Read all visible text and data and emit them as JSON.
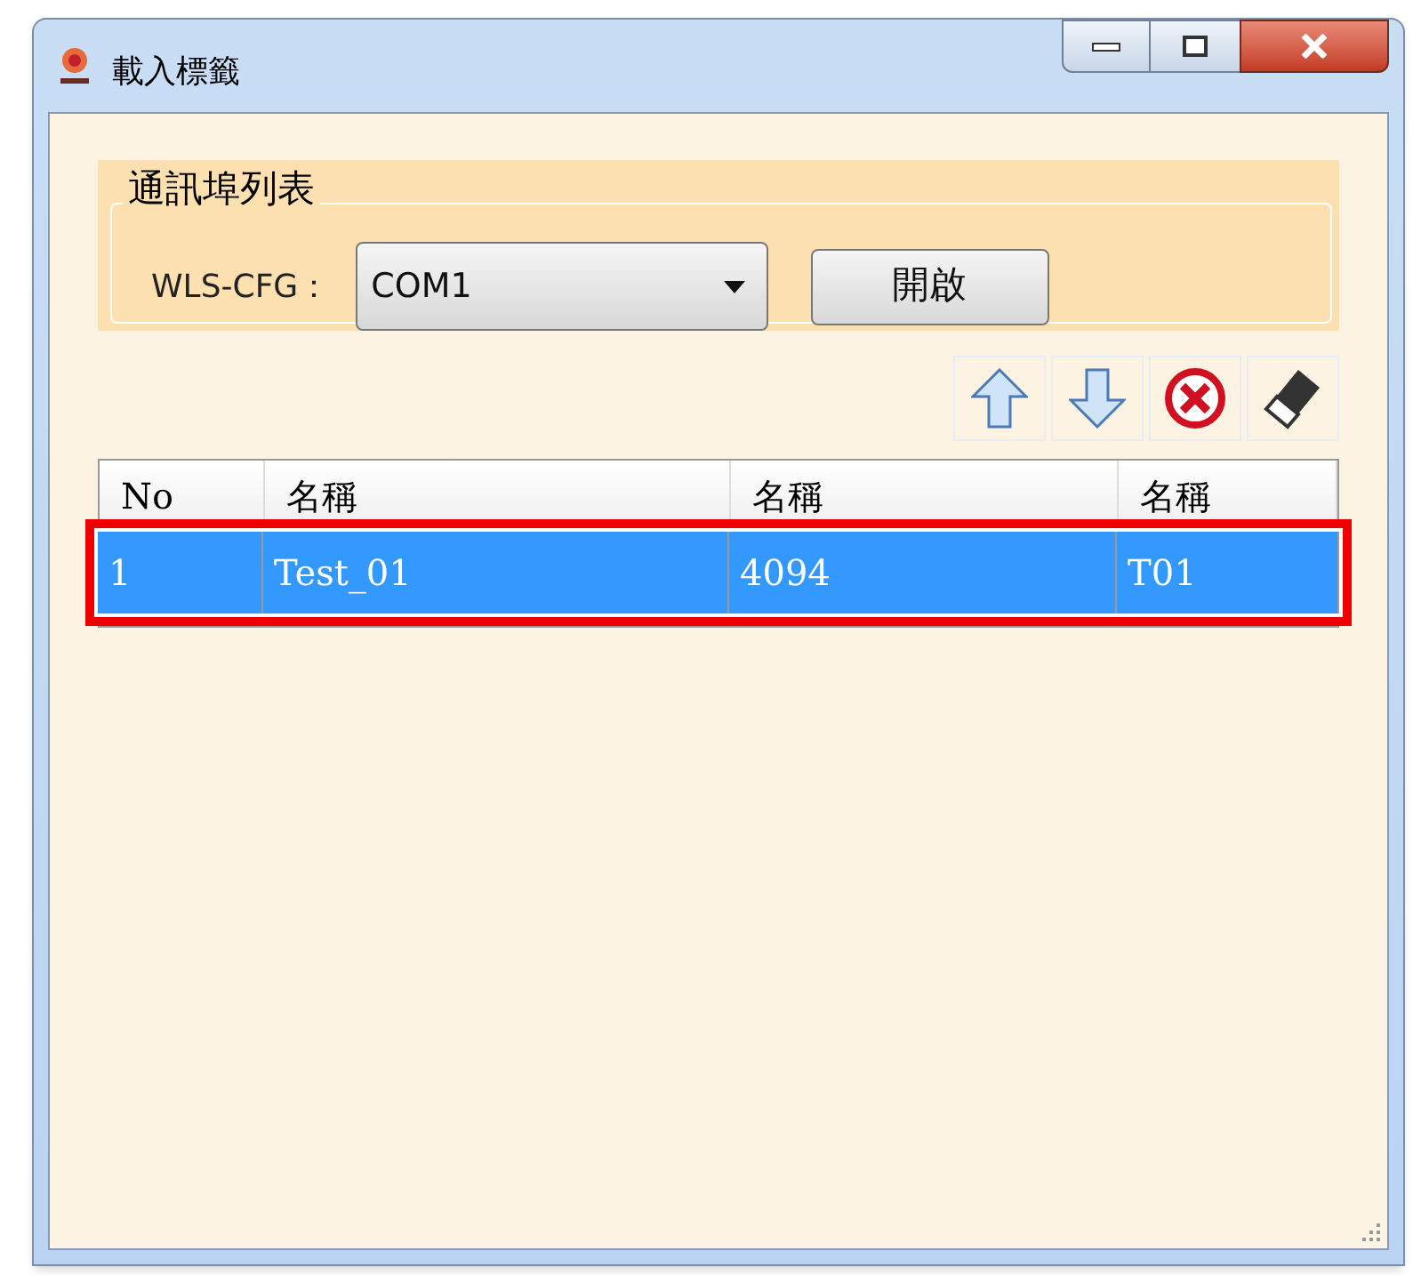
{
  "window": {
    "title": "載入標籤"
  },
  "port_group": {
    "title": "通訊埠列表",
    "label": "WLS-CFG：",
    "port": "COM1",
    "open_button": "開啟"
  },
  "table": {
    "columns": [
      "No",
      "名稱",
      "名稱",
      "名稱"
    ],
    "rows": [
      {
        "cells": [
          "1",
          "Test_01",
          "4094",
          "T01"
        ],
        "selected": true,
        "highlighted": true
      }
    ]
  }
}
